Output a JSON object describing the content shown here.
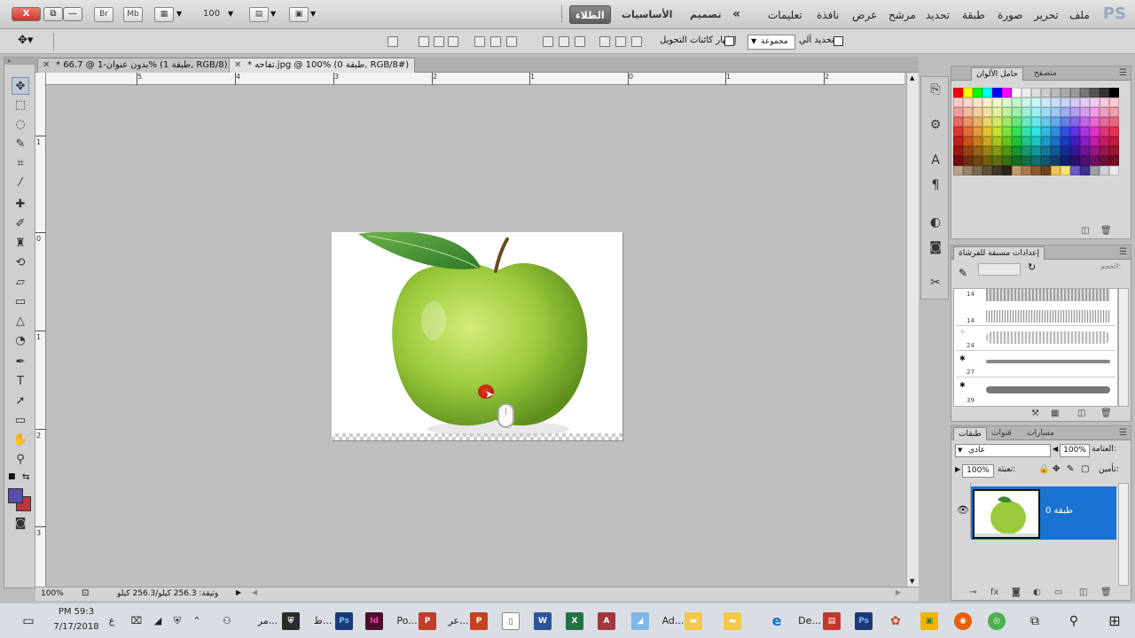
{
  "app": {
    "logo": "PS",
    "zoom": "100",
    "app_buttons": [
      "Br",
      "Mb"
    ],
    "window_buttons": {
      "close": "X",
      "restore": "⧉",
      "minimize": "—"
    }
  },
  "menu": {
    "items": [
      "ملف",
      "تحرير",
      "صورة",
      "طبقة",
      "تحديد",
      "مرشح",
      "عرض",
      "نافذة",
      "تعليمات"
    ],
    "workspaces": {
      "active": "الظلاء",
      "essentials": "الأساسيات",
      "design": "تصميم"
    },
    "more": "«"
  },
  "options": {
    "auto_select_label": "تحديد آلي:",
    "auto_select_value": "مجموعة",
    "show_transform_label": "إظهار كائنات التحويل"
  },
  "tabs": [
    {
      "title": "* تفاحه.jpg @ 100% (طبقة 0, RGB/8#)",
      "active": true
    },
    {
      "title": "* بدون عنوان-1 @ 66.7% (طبقة 1, RGB/8)",
      "active": false
    }
  ],
  "rulers": {
    "horizontal": [
      "5",
      "4",
      "3",
      "2",
      "1",
      "0",
      "1",
      "2"
    ],
    "vertical": [
      "1",
      "0",
      "1",
      "2",
      "3"
    ]
  },
  "status": {
    "zoom": "100%",
    "doc_info": "وثيقة: 256.3 كيلو/256.3 كيلو"
  },
  "panels": {
    "swatches": {
      "tabs": [
        "متصفح",
        "حامل الألوان"
      ]
    },
    "brushes": {
      "title": "إعدادات مسبقة للفرشاة",
      "size_label": "الحجم:",
      "sizes": [
        "14",
        "14",
        "24",
        "27",
        "39",
        "25"
      ]
    },
    "layers": {
      "tabs": [
        "مسارات",
        "قنوات",
        "طبقات"
      ],
      "blend_mode": "عادي",
      "opacity_label": "العتامة:",
      "opacity_value": "100%",
      "lock_label": "تأمين:",
      "fill_label": "تعبئة:",
      "fill_value": "100%",
      "layer_name": "طبقة 0"
    }
  },
  "colors": {
    "foreground": "#5a4ea6",
    "background": "#b8363c",
    "selection_blue": "#1a73d0",
    "apple_green": "#9bcb3c"
  },
  "taskbar": {
    "time": "PM 59:3",
    "date": "7/17/2018",
    "lang": "ع",
    "items": [
      "مر...",
      "ط...",
      "Po...",
      "عر...",
      "Ad...",
      "De..."
    ]
  }
}
